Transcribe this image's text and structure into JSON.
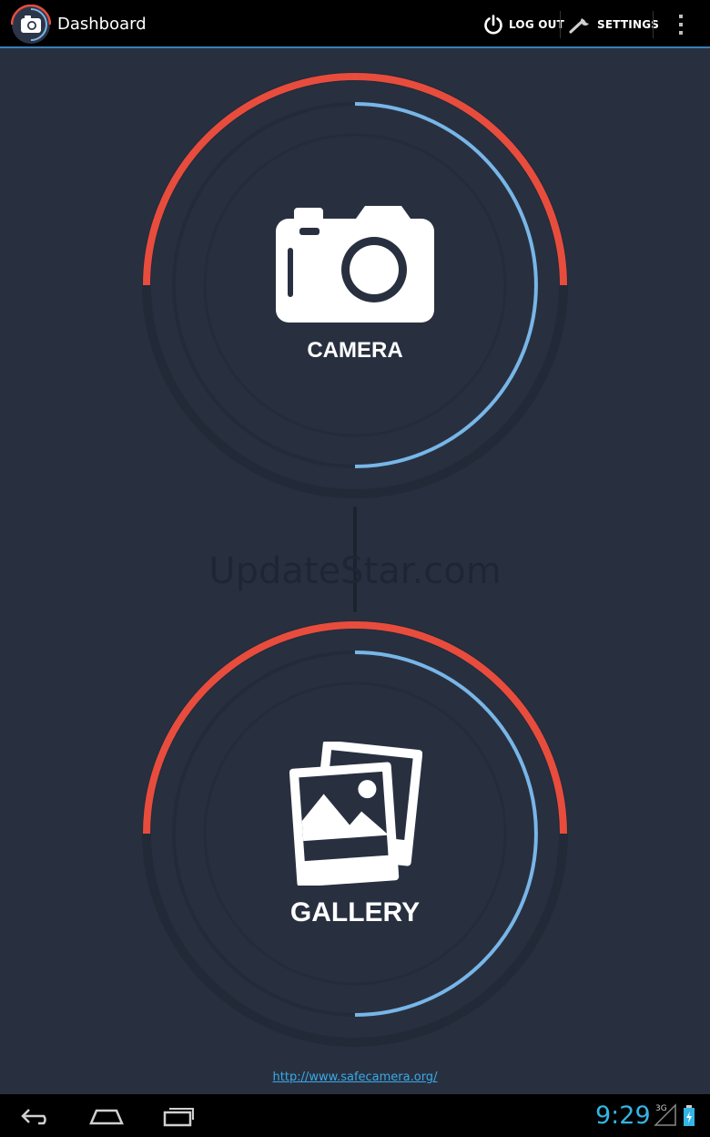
{
  "action_bar": {
    "title": "Dashboard",
    "logout_label": "LOG OUT",
    "settings_label": "SETTINGS"
  },
  "main": {
    "camera_label": "CAMERA",
    "gallery_label": "GALLERY",
    "watermark": "UpdateStar.com",
    "link": "http://www.safecamera.org/"
  },
  "status_bar": {
    "time": "9:29",
    "network": "3G"
  },
  "colors": {
    "background": "#283040",
    "accent_red": "#e84c3d",
    "accent_blue": "#78b6e8",
    "link": "#3aa9e6",
    "clock": "#33b5e5"
  },
  "icons": {
    "app": "camera-app-icon",
    "logout": "power-icon",
    "settings": "wrench-icon",
    "overflow": "overflow-menu-icon",
    "camera": "camera-icon",
    "gallery": "photos-icon",
    "back": "back-icon",
    "home": "home-icon",
    "recents": "recents-icon"
  }
}
